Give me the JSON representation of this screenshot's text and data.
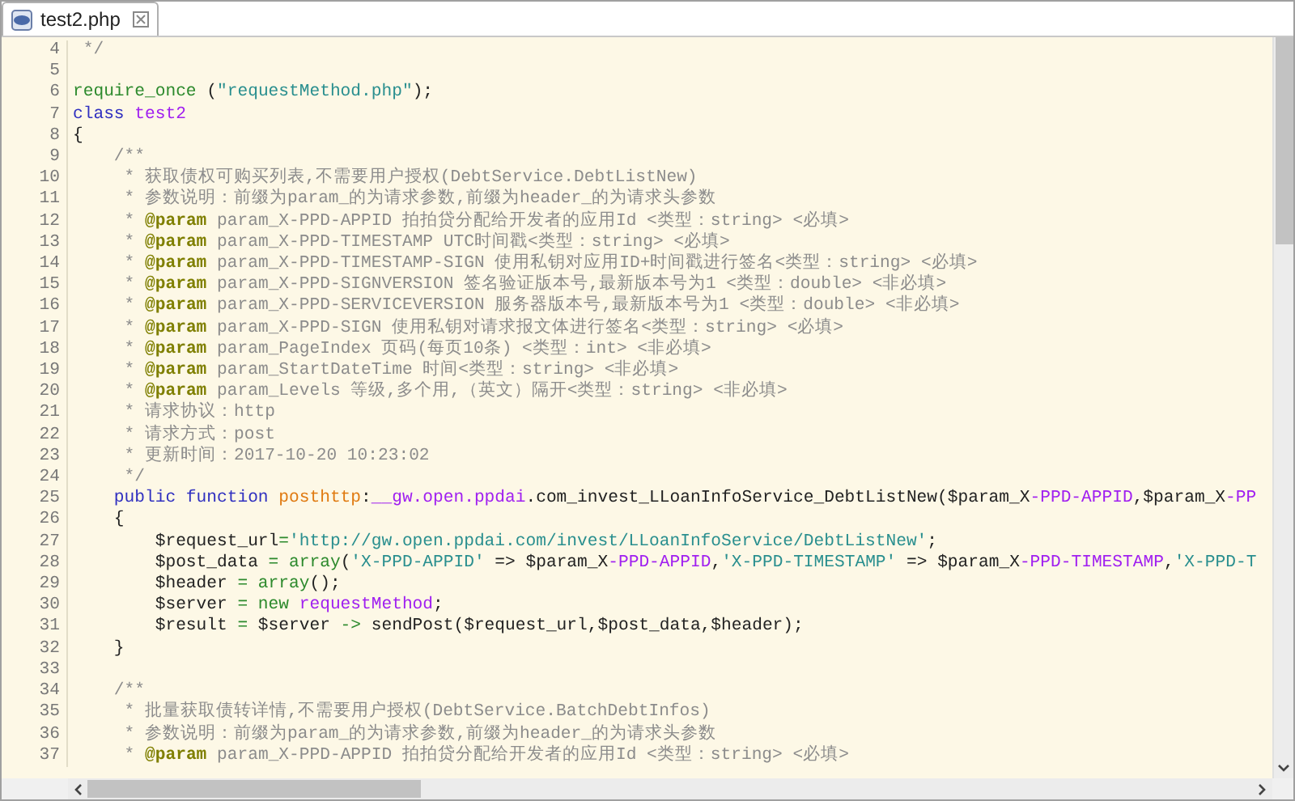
{
  "tab": {
    "title": "test2.php",
    "selected": true
  },
  "lines": [
    {
      "number": "4",
      "segments": [
        {
          "kind": "comment",
          "text": " */"
        }
      ]
    },
    {
      "number": "5"
    },
    {
      "number": "6",
      "segments": [
        {
          "kind": "builtin",
          "text": "require_once"
        },
        {
          "kind": "plain",
          "text": " ("
        },
        {
          "kind": "string",
          "text": "\"requestMethod.php\""
        },
        {
          "kind": "plain",
          "text": ");"
        }
      ]
    },
    {
      "number": "7",
      "segments": [
        {
          "kind": "keyword",
          "text": "class "
        },
        {
          "kind": "classname",
          "text": "test2"
        }
      ]
    },
    {
      "number": "8",
      "segments": [
        {
          "kind": "plain",
          "text": "{"
        }
      ]
    },
    {
      "number": "9",
      "segments": [
        {
          "kind": "comment",
          "text": "    /**"
        }
      ]
    },
    {
      "number": "10",
      "segments": [
        {
          "kind": "comment",
          "text": "     * 获取债权可购买列表,不需要用户授权(DebtService.DebtListNew)"
        }
      ]
    },
    {
      "number": "11",
      "segments": [
        {
          "kind": "comment",
          "text": "     * 参数说明：前缀为param_的为请求参数,前缀为header_的为请求头参数"
        }
      ]
    },
    {
      "number": "12",
      "segments": [
        {
          "kind": "comment",
          "text": "     * "
        },
        {
          "kind": "tag",
          "text": "@param"
        },
        {
          "kind": "comment",
          "text": " param_X-PPD-APPID 拍拍贷分配给开发者的应用Id <类型：string> <必填>"
        }
      ]
    },
    {
      "number": "13",
      "segments": [
        {
          "kind": "comment",
          "text": "     * "
        },
        {
          "kind": "tag",
          "text": "@param"
        },
        {
          "kind": "comment",
          "text": " param_X-PPD-TIMESTAMP UTC时间戳<类型：string> <必填>"
        }
      ]
    },
    {
      "number": "14",
      "segments": [
        {
          "kind": "comment",
          "text": "     * "
        },
        {
          "kind": "tag",
          "text": "@param"
        },
        {
          "kind": "comment",
          "text": " param_X-PPD-TIMESTAMP-SIGN 使用私钥对应用ID+时间戳进行签名<类型：string> <必填>"
        }
      ]
    },
    {
      "number": "15",
      "segments": [
        {
          "kind": "comment",
          "text": "     * "
        },
        {
          "kind": "tag",
          "text": "@param"
        },
        {
          "kind": "comment",
          "text": " param_X-PPD-SIGNVERSION 签名验证版本号,最新版本号为1 <类型：double> <非必填>"
        }
      ]
    },
    {
      "number": "16",
      "segments": [
        {
          "kind": "comment",
          "text": "     * "
        },
        {
          "kind": "tag",
          "text": "@param"
        },
        {
          "kind": "comment",
          "text": " param_X-PPD-SERVICEVERSION 服务器版本号,最新版本号为1 <类型：double> <非必填>"
        }
      ]
    },
    {
      "number": "17",
      "segments": [
        {
          "kind": "comment",
          "text": "     * "
        },
        {
          "kind": "tag",
          "text": "@param"
        },
        {
          "kind": "comment",
          "text": " param_X-PPD-SIGN 使用私钥对请求报文体进行签名<类型：string> <必填>"
        }
      ]
    },
    {
      "number": "18",
      "segments": [
        {
          "kind": "comment",
          "text": "     * "
        },
        {
          "kind": "tag",
          "text": "@param"
        },
        {
          "kind": "comment",
          "text": " param_PageIndex 页码(每页10条) <类型：int> <非必填>"
        }
      ]
    },
    {
      "number": "19",
      "segments": [
        {
          "kind": "comment",
          "text": "     * "
        },
        {
          "kind": "tag",
          "text": "@param"
        },
        {
          "kind": "comment",
          "text": " param_StartDateTime 时间<类型：string> <非必填>"
        }
      ]
    },
    {
      "number": "20",
      "segments": [
        {
          "kind": "comment",
          "text": "     * "
        },
        {
          "kind": "tag",
          "text": "@param"
        },
        {
          "kind": "comment",
          "text": " param_Levels 等级,多个用,（英文）隔开<类型：string> <非必填>"
        }
      ]
    },
    {
      "number": "21",
      "segments": [
        {
          "kind": "comment",
          "text": "     * 请求协议：http"
        }
      ]
    },
    {
      "number": "22",
      "segments": [
        {
          "kind": "comment",
          "text": "     * 请求方式：post"
        }
      ]
    },
    {
      "number": "23",
      "segments": [
        {
          "kind": "comment",
          "text": "     * 更新时间：2017-10-20 10:23:02"
        }
      ]
    },
    {
      "number": "24",
      "segments": [
        {
          "kind": "comment",
          "text": "     */"
        }
      ]
    },
    {
      "number": "25",
      "segments": [
        {
          "kind": "keyword",
          "text": "    public function "
        },
        {
          "kind": "func",
          "text": "posthttp"
        },
        {
          "kind": "plain",
          "text": ":"
        },
        {
          "kind": "classname",
          "text": "__gw.open.ppdai"
        },
        {
          "kind": "plain",
          "text": ".com_invest_LLoanInfoService_DebtListNew($param_X"
        },
        {
          "kind": "classname",
          "text": "-PPD-APPID"
        },
        {
          "kind": "plain",
          "text": ",$param_X"
        },
        {
          "kind": "classname",
          "text": "-PP"
        }
      ]
    },
    {
      "number": "26",
      "segments": [
        {
          "kind": "plain",
          "text": "    {"
        }
      ]
    },
    {
      "number": "27",
      "segments": [
        {
          "kind": "plain",
          "text": "        $request_url"
        },
        {
          "kind": "builtin",
          "text": "="
        },
        {
          "kind": "string",
          "text": "'http://gw.open.ppdai.com/invest/LLoanInfoService/DebtListNew'"
        },
        {
          "kind": "plain",
          "text": ";"
        }
      ]
    },
    {
      "number": "28",
      "segments": [
        {
          "kind": "plain",
          "text": "        $post_data "
        },
        {
          "kind": "builtin",
          "text": "= array"
        },
        {
          "kind": "plain",
          "text": "("
        },
        {
          "kind": "string",
          "text": "'X-PPD-APPID'"
        },
        {
          "kind": "plain",
          "text": " => $param_X"
        },
        {
          "kind": "classname",
          "text": "-PPD-APPID"
        },
        {
          "kind": "plain",
          "text": ","
        },
        {
          "kind": "string",
          "text": "'X-PPD-TIMESTAMP'"
        },
        {
          "kind": "plain",
          "text": " => $param_X"
        },
        {
          "kind": "classname",
          "text": "-PPD-TIMESTAMP"
        },
        {
          "kind": "plain",
          "text": ","
        },
        {
          "kind": "string",
          "text": "'X-PPD-T"
        }
      ]
    },
    {
      "number": "29",
      "segments": [
        {
          "kind": "plain",
          "text": "        $header "
        },
        {
          "kind": "builtin",
          "text": "= array"
        },
        {
          "kind": "plain",
          "text": "();"
        }
      ]
    },
    {
      "number": "30",
      "segments": [
        {
          "kind": "plain",
          "text": "        $server "
        },
        {
          "kind": "builtin",
          "text": "= new "
        },
        {
          "kind": "classname",
          "text": "requestMethod"
        },
        {
          "kind": "plain",
          "text": ";"
        }
      ]
    },
    {
      "number": "31",
      "segments": [
        {
          "kind": "plain",
          "text": "        $result "
        },
        {
          "kind": "builtin",
          "text": "="
        },
        {
          "kind": "plain",
          "text": " $server "
        },
        {
          "kind": "builtin",
          "text": "->"
        },
        {
          "kind": "plain",
          "text": " sendPost($request_url,$post_data,$header);"
        }
      ]
    },
    {
      "number": "32",
      "segments": [
        {
          "kind": "plain",
          "text": "    }"
        }
      ]
    },
    {
      "number": "33"
    },
    {
      "number": "34",
      "segments": [
        {
          "kind": "comment",
          "text": "    /**"
        }
      ]
    },
    {
      "number": "35",
      "segments": [
        {
          "kind": "comment",
          "text": "     * 批量获取债转详情,不需要用户授权(DebtService.BatchDebtInfos)"
        }
      ]
    },
    {
      "number": "36",
      "segments": [
        {
          "kind": "comment",
          "text": "     * 参数说明：前缀为param_的为请求参数,前缀为header_的为请求头参数"
        }
      ]
    },
    {
      "number": "37",
      "segments": [
        {
          "kind": "comment",
          "text": "     * "
        },
        {
          "kind": "tag",
          "text": "@param"
        },
        {
          "kind": "comment",
          "text": " param_X-PPD-APPID 拍拍贷分配给开发者的应用Id <类型：string> <必填>"
        }
      ]
    }
  ]
}
